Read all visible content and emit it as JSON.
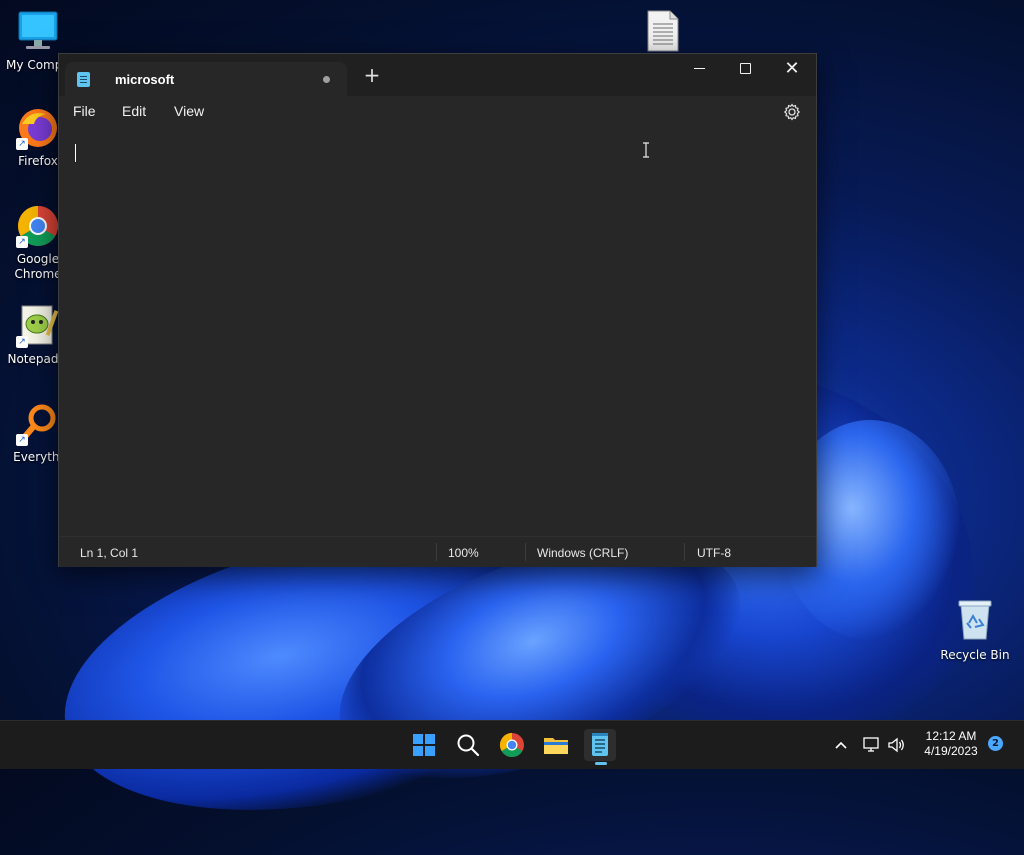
{
  "desktop": {
    "icons": [
      {
        "label": "My Compu",
        "icon": "computer-icon"
      },
      {
        "label": "Firefox",
        "icon": "firefox-icon"
      },
      {
        "label": "Google Chrome",
        "line1": "Google",
        "line2": "Chrome",
        "icon": "chrome-icon"
      },
      {
        "label": "Notepad+",
        "icon": "notepad-plus-plus-icon"
      },
      {
        "label": "Everythi",
        "icon": "everything-search-icon"
      }
    ],
    "recycle_bin": {
      "label": "Recycle Bin",
      "icon": "recycle-bin-icon"
    },
    "file_icon": "document-icon"
  },
  "notepad": {
    "tab_title": "microsoft",
    "menu": {
      "file": "File",
      "edit": "Edit",
      "view": "View"
    },
    "status": {
      "position": "Ln 1, Col 1",
      "zoom": "100%",
      "line_ending": "Windows (CRLF)",
      "encoding": "UTF-8"
    }
  },
  "taskbar": {
    "apps": [
      "start-icon",
      "search-icon",
      "chrome-icon",
      "file-explorer-icon",
      "notepad-icon"
    ],
    "clock_time": "12:12 AM",
    "clock_date": "4/19/2023",
    "notification_count": "2"
  },
  "colors": {
    "window_bg": "#272727",
    "titlebar_bg": "#202020",
    "accent": "#5fc4f0"
  }
}
